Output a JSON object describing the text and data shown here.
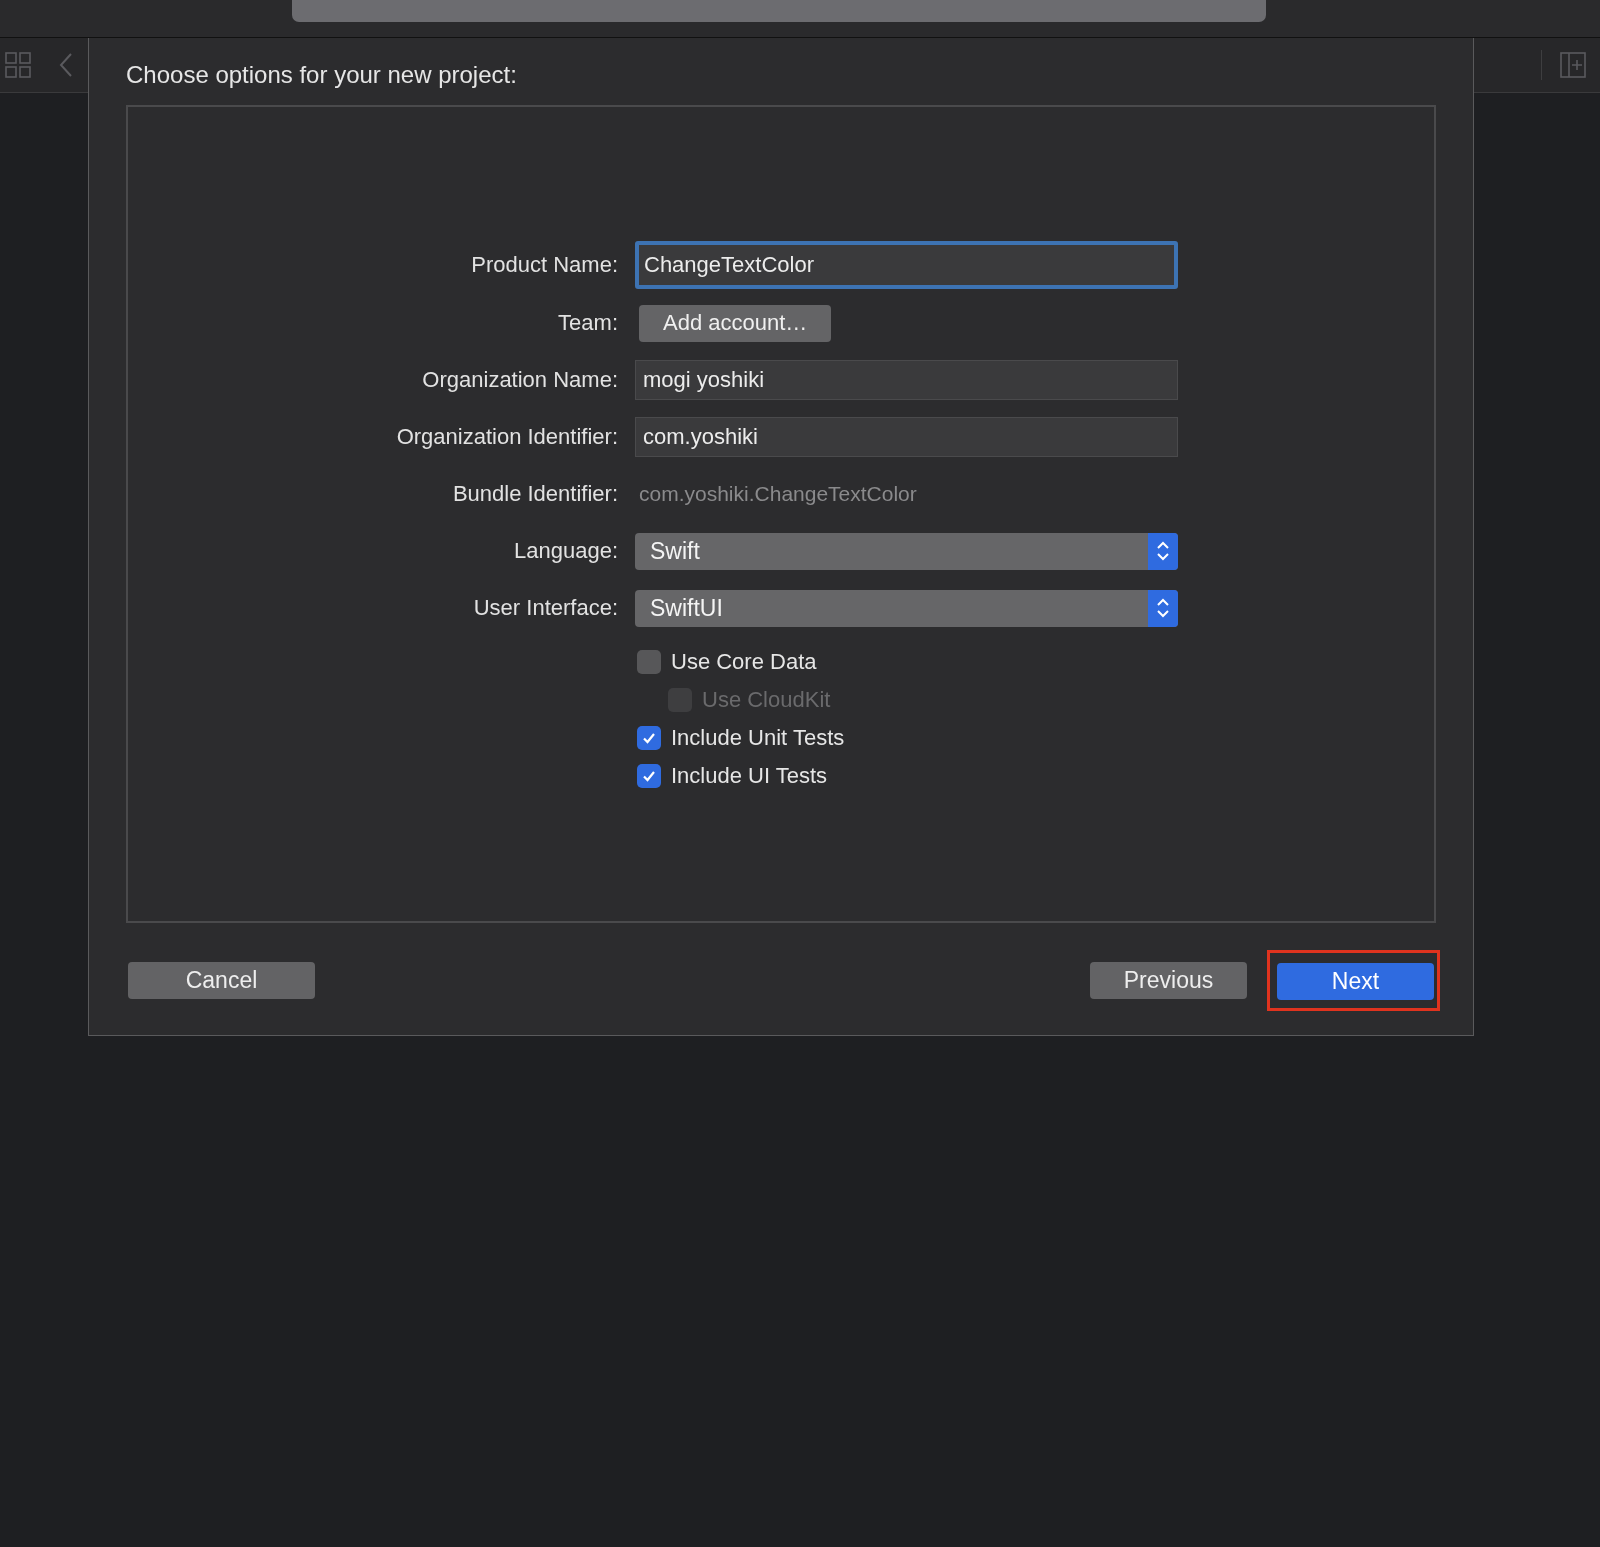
{
  "title": "Choose options for your new project:",
  "fields": [
    {
      "kind": "text",
      "label": "Product Name:",
      "value": "ChangeTextColor",
      "focused": true
    },
    {
      "kind": "button",
      "label": "Team:",
      "value": "Add account…"
    },
    {
      "kind": "text",
      "label": "Organization Name:",
      "value": "mogi yoshiki",
      "focused": false
    },
    {
      "kind": "text",
      "label": "Organization Identifier:",
      "value": "com.yoshiki",
      "focused": false
    },
    {
      "kind": "static",
      "label": "Bundle Identifier:",
      "value": "com.yoshiki.ChangeTextColor"
    },
    {
      "kind": "popup",
      "label": "Language:",
      "value": "Swift"
    },
    {
      "kind": "popup",
      "label": "User Interface:",
      "value": "SwiftUI"
    }
  ],
  "options": [
    {
      "label": "Use Core Data",
      "checked": false,
      "disabled": false,
      "children": [
        {
          "label": "Use CloudKit",
          "checked": false,
          "disabled": true
        }
      ]
    },
    {
      "label": "Include Unit Tests",
      "checked": true,
      "disabled": false
    },
    {
      "label": "Include UI Tests",
      "checked": true,
      "disabled": false
    }
  ],
  "buttons": [
    {
      "label": "Cancel",
      "kind": "normal",
      "highlighted": false
    },
    {
      "label": "Previous",
      "kind": "normal",
      "highlighted": false
    },
    {
      "label": "Next",
      "kind": "default",
      "highlighted": true
    }
  ]
}
